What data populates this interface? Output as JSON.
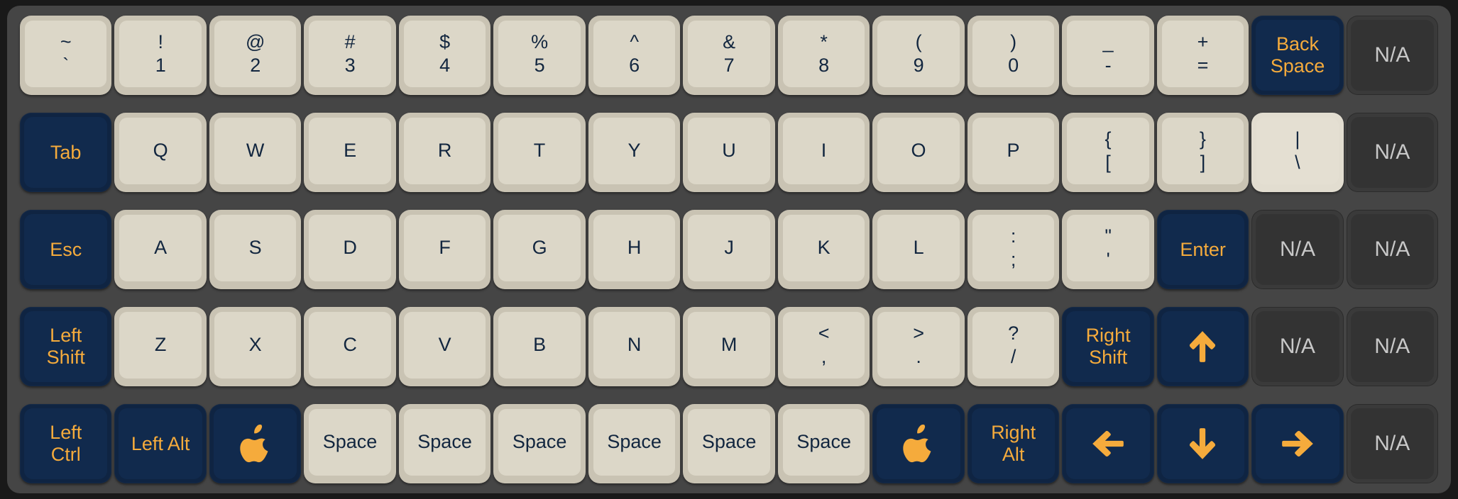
{
  "theme": {
    "page_background": "#191919",
    "chassis_background": "#454545",
    "light_key_face": "#dcd7c8",
    "light_key_rim": "#c9c3b3",
    "light_key_text": "#12263f",
    "modifier_key_face": "#112a4d",
    "modifier_key_rim": "#0f2442",
    "modifier_key_text": "#f5ab3c",
    "disabled_key_face": "#333333",
    "disabled_key_text": "#c8c8c8",
    "accent": "#f5ab3c"
  },
  "keyboard": {
    "columns": 15,
    "rows": 5,
    "disabled_label": "N/A",
    "rows_data": [
      {
        "name": "number-row",
        "keys": [
          {
            "name": "backtick",
            "style": "light",
            "top": "~",
            "bottom": "`"
          },
          {
            "name": "digit-1",
            "style": "light",
            "top": "!",
            "bottom": "1"
          },
          {
            "name": "digit-2",
            "style": "light",
            "top": "@",
            "bottom": "2"
          },
          {
            "name": "digit-3",
            "style": "light",
            "top": "#",
            "bottom": "3"
          },
          {
            "name": "digit-4",
            "style": "light",
            "top": "$",
            "bottom": "4"
          },
          {
            "name": "digit-5",
            "style": "light",
            "top": "%",
            "bottom": "5"
          },
          {
            "name": "digit-6",
            "style": "light",
            "top": "^",
            "bottom": "6"
          },
          {
            "name": "digit-7",
            "style": "light",
            "top": "&",
            "bottom": "7"
          },
          {
            "name": "digit-8",
            "style": "light",
            "top": "*",
            "bottom": "8"
          },
          {
            "name": "digit-9",
            "style": "light",
            "top": "(",
            "bottom": "9"
          },
          {
            "name": "digit-0",
            "style": "light",
            "top": ")",
            "bottom": "0"
          },
          {
            "name": "minus",
            "style": "light",
            "top": "_",
            "bottom": "-"
          },
          {
            "name": "equals",
            "style": "light",
            "top": "+",
            "bottom": "="
          },
          {
            "name": "backspace",
            "style": "navy",
            "words": [
              "Back",
              "Space"
            ]
          },
          {
            "name": "na-r1c15",
            "style": "disabled",
            "label": "N/A"
          }
        ]
      },
      {
        "name": "top-letter-row",
        "keys": [
          {
            "name": "tab",
            "style": "navy",
            "label": "Tab"
          },
          {
            "name": "letter-q",
            "style": "light",
            "label": "Q"
          },
          {
            "name": "letter-w",
            "style": "light",
            "label": "W"
          },
          {
            "name": "letter-e",
            "style": "light",
            "label": "E"
          },
          {
            "name": "letter-r",
            "style": "light",
            "label": "R"
          },
          {
            "name": "letter-t",
            "style": "light",
            "label": "T"
          },
          {
            "name": "letter-y",
            "style": "light",
            "label": "Y"
          },
          {
            "name": "letter-u",
            "style": "light",
            "label": "U"
          },
          {
            "name": "letter-i",
            "style": "light",
            "label": "I"
          },
          {
            "name": "letter-o",
            "style": "light",
            "label": "O"
          },
          {
            "name": "letter-p",
            "style": "light",
            "label": "P"
          },
          {
            "name": "bracket-left",
            "style": "light",
            "top": "{",
            "bottom": "["
          },
          {
            "name": "bracket-right",
            "style": "light",
            "top": "}",
            "bottom": "]"
          },
          {
            "name": "backslash",
            "style": "light",
            "highlighted": true,
            "top": "|",
            "bottom": "\\"
          },
          {
            "name": "na-r2c15",
            "style": "disabled",
            "label": "N/A"
          }
        ]
      },
      {
        "name": "home-row",
        "keys": [
          {
            "name": "escape",
            "style": "navy",
            "label": "Esc"
          },
          {
            "name": "letter-a",
            "style": "light",
            "label": "A"
          },
          {
            "name": "letter-s",
            "style": "light",
            "label": "S"
          },
          {
            "name": "letter-d",
            "style": "light",
            "label": "D"
          },
          {
            "name": "letter-f",
            "style": "light",
            "label": "F"
          },
          {
            "name": "letter-g",
            "style": "light",
            "label": "G"
          },
          {
            "name": "letter-h",
            "style": "light",
            "label": "H"
          },
          {
            "name": "letter-j",
            "style": "light",
            "label": "J"
          },
          {
            "name": "letter-k",
            "style": "light",
            "label": "K"
          },
          {
            "name": "letter-l",
            "style": "light",
            "label": "L"
          },
          {
            "name": "semicolon",
            "style": "light",
            "top": ":",
            "bottom": ";"
          },
          {
            "name": "quote",
            "style": "light",
            "top": "\"",
            "bottom": "'"
          },
          {
            "name": "enter",
            "style": "navy",
            "label": "Enter"
          },
          {
            "name": "na-r3c14",
            "style": "disabled",
            "label": "N/A"
          },
          {
            "name": "na-r3c15",
            "style": "disabled",
            "label": "N/A"
          }
        ]
      },
      {
        "name": "bottom-letter-row",
        "keys": [
          {
            "name": "left-shift",
            "style": "navy",
            "words": [
              "Left",
              "Shift"
            ]
          },
          {
            "name": "letter-z",
            "style": "light",
            "label": "Z"
          },
          {
            "name": "letter-x",
            "style": "light",
            "label": "X"
          },
          {
            "name": "letter-c",
            "style": "light",
            "label": "C"
          },
          {
            "name": "letter-v",
            "style": "light",
            "label": "V"
          },
          {
            "name": "letter-b",
            "style": "light",
            "label": "B"
          },
          {
            "name": "letter-n",
            "style": "light",
            "label": "N"
          },
          {
            "name": "letter-m",
            "style": "light",
            "label": "M"
          },
          {
            "name": "comma",
            "style": "light",
            "top": "<",
            "bottom": ","
          },
          {
            "name": "period",
            "style": "light",
            "top": ">",
            "bottom": "."
          },
          {
            "name": "slash",
            "style": "light",
            "top": "?",
            "bottom": "/"
          },
          {
            "name": "right-shift",
            "style": "navy",
            "words": [
              "Right",
              "Shift"
            ]
          },
          {
            "name": "arrow-up",
            "style": "navy",
            "icon": "arrow-up-icon"
          },
          {
            "name": "na-r4c14",
            "style": "disabled",
            "label": "N/A"
          },
          {
            "name": "na-r4c15",
            "style": "disabled",
            "label": "N/A"
          }
        ]
      },
      {
        "name": "modifier-row",
        "keys": [
          {
            "name": "left-ctrl",
            "style": "navy",
            "words": [
              "Left",
              "Ctrl"
            ]
          },
          {
            "name": "left-alt",
            "style": "navy",
            "label": "Left Alt"
          },
          {
            "name": "left-command",
            "style": "navy",
            "icon": "apple-icon"
          },
          {
            "name": "space-1",
            "style": "light",
            "label": "Space"
          },
          {
            "name": "space-2",
            "style": "light",
            "label": "Space"
          },
          {
            "name": "space-3",
            "style": "light",
            "label": "Space"
          },
          {
            "name": "space-4",
            "style": "light",
            "label": "Space"
          },
          {
            "name": "space-5",
            "style": "light",
            "label": "Space"
          },
          {
            "name": "space-6",
            "style": "light",
            "label": "Space"
          },
          {
            "name": "right-command",
            "style": "navy",
            "icon": "apple-icon"
          },
          {
            "name": "right-alt",
            "style": "navy",
            "words": [
              "Right",
              "Alt"
            ]
          },
          {
            "name": "arrow-left",
            "style": "navy",
            "icon": "arrow-left-icon"
          },
          {
            "name": "arrow-down",
            "style": "navy",
            "icon": "arrow-down-icon"
          },
          {
            "name": "arrow-right",
            "style": "navy",
            "icon": "arrow-right-icon"
          },
          {
            "name": "na-r5c15",
            "style": "disabled",
            "label": "N/A"
          }
        ]
      }
    ]
  }
}
